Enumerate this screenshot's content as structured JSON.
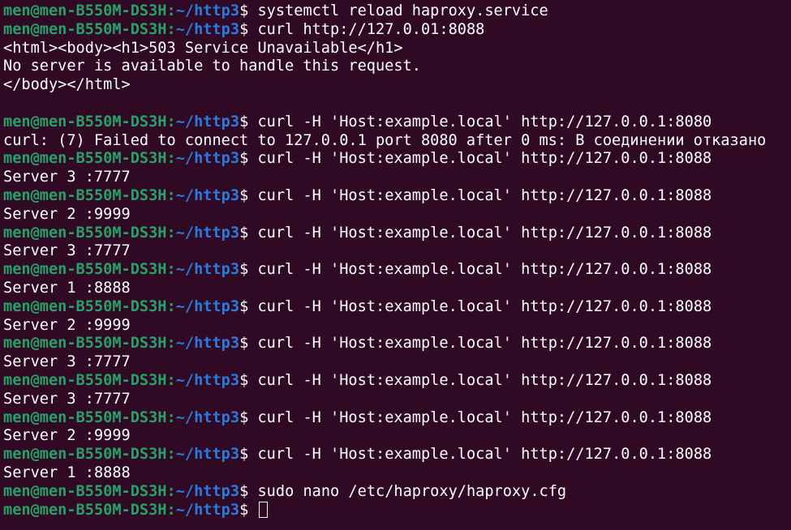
{
  "prompt": {
    "user_host": "men@men-B550M-DS3H",
    "colon": ":",
    "path": "~/http3",
    "dollar": "$"
  },
  "colors": {
    "background": "#300a24",
    "user_host": "#26a269",
    "path": "#2a7bde",
    "text": "#ffffff"
  },
  "lines": [
    {
      "type": "prompt",
      "cmd": "systemctl reload haproxy.service"
    },
    {
      "type": "prompt",
      "cmd": "curl http://127.0.01:8088"
    },
    {
      "type": "output",
      "text": "<html><body><h1>503 Service Unavailable</h1>"
    },
    {
      "type": "output",
      "text": "No server is available to handle this request."
    },
    {
      "type": "output",
      "text": "</body></html>"
    },
    {
      "type": "output",
      "text": ""
    },
    {
      "type": "prompt",
      "cmd": "curl -H 'Host:example.local' http://127.0.0.1:8080"
    },
    {
      "type": "output",
      "text": "curl: (7) Failed to connect to 127.0.0.1 port 8080 after 0 ms: В соединении отказано"
    },
    {
      "type": "prompt",
      "cmd": "curl -H 'Host:example.local' http://127.0.0.1:8088"
    },
    {
      "type": "output",
      "text": "Server 3 :7777"
    },
    {
      "type": "prompt",
      "cmd": "curl -H 'Host:example.local' http://127.0.0.1:8088"
    },
    {
      "type": "output",
      "text": "Server 2 :9999"
    },
    {
      "type": "prompt",
      "cmd": "curl -H 'Host:example.local' http://127.0.0.1:8088"
    },
    {
      "type": "output",
      "text": "Server 3 :7777"
    },
    {
      "type": "prompt",
      "cmd": "curl -H 'Host:example.local' http://127.0.0.1:8088"
    },
    {
      "type": "output",
      "text": "Server 1 :8888"
    },
    {
      "type": "prompt",
      "cmd": "curl -H 'Host:example.local' http://127.0.0.1:8088"
    },
    {
      "type": "output",
      "text": "Server 2 :9999"
    },
    {
      "type": "prompt",
      "cmd": "curl -H 'Host:example.local' http://127.0.0.1:8088"
    },
    {
      "type": "output",
      "text": "Server 3 :7777"
    },
    {
      "type": "prompt",
      "cmd": "curl -H 'Host:example.local' http://127.0.0.1:8088"
    },
    {
      "type": "output",
      "text": "Server 3 :7777"
    },
    {
      "type": "prompt",
      "cmd": "curl -H 'Host:example.local' http://127.0.0.1:8088"
    },
    {
      "type": "output",
      "text": "Server 2 :9999"
    },
    {
      "type": "prompt",
      "cmd": "curl -H 'Host:example.local' http://127.0.0.1:8088"
    },
    {
      "type": "output",
      "text": "Server 1 :8888"
    },
    {
      "type": "prompt",
      "cmd": "sudo nano /etc/haproxy/haproxy.cfg"
    },
    {
      "type": "prompt_active",
      "cmd": ""
    }
  ]
}
